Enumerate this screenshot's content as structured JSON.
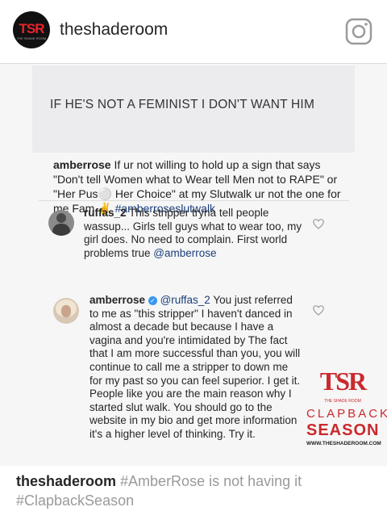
{
  "header": {
    "avatar_logo_text": "TSR",
    "avatar_logo_sub": "THE SHADE ROOM",
    "username": "theshaderoom",
    "icon": "instagram-icon"
  },
  "post": {
    "card_text": "IF HE'S NOT A FEMINIST I DON'T WANT HIM",
    "caption": {
      "user": "amberrose",
      "text": " If ur not willing to hold up a sign that says \"Don't tell Women what to Wear tell Men not to RAPE\" or \"Her Pus⚪ Her Choice\" at my Slutwalk ur not the one for me Fam ✌️ ",
      "hashtag": "#amberroseslutwalk"
    },
    "comments": [
      {
        "user": "ruffas_2",
        "text": " This stripper tryna tell people wassup... Girls tell guys what to wear too, my girl does. No need to complain. First world problems true ",
        "mention": "@amberrose",
        "verified": false
      },
      {
        "user": "amberrose",
        "mention": "@ruffas_2",
        "text": " You just referred to me as \"this stripper\" I haven't danced in almost a decade but because I have a vagina and you're intimidated by The fact that I am more successful than you, you will continue to call me a stripper to down me for my past so you can feel superior. I get it. People like you are the main reason why I started slut walk. You should go to the website in my bio and get more information it's a higher level of thinking. Try it.",
        "verified": true,
        "verified_mark": "✓"
      }
    ],
    "watermark": {
      "logo": "TSR",
      "sub": "THE SHADE ROOM",
      "line1": "CLAPBACK",
      "line2": "SEASON",
      "url": "WWW.THESHADEROOM.COM"
    }
  },
  "footer": {
    "user": "theshaderoom",
    "text": " #AmberRose is not having it #ClapbackSeason"
  },
  "colors": {
    "brand_red": "#c92a2e",
    "link_blue": "#1c3f7a",
    "verified_blue": "#3897f0"
  }
}
